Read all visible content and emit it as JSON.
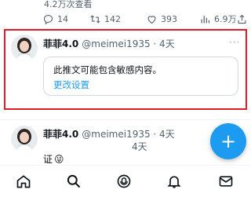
{
  "prev_tweet": {
    "views_text": "4.2万次查看",
    "stats": {
      "replies": "14",
      "retweets": "142",
      "likes": "393",
      "views": "6.9万"
    }
  },
  "tweet1": {
    "name": "菲菲4.0",
    "handle_time": "@meimei1935 · 4天",
    "more": "···",
    "sensitive_text": "此推文可能包含敏感内容。",
    "settings_link": "更改设置"
  },
  "tweet2": {
    "name": "菲菲4.0",
    "handle_time": "@meimei1935 · 4天",
    "time2": "4天",
    "body": "证",
    "emoji": "😜"
  },
  "fab": {
    "symbol": "+"
  },
  "colors": {
    "accent": "#1d9bf0",
    "highlight": "#e01e2b",
    "secondary": "#536471"
  },
  "icons": [
    "reply-icon",
    "retweet-icon",
    "like-icon",
    "views-icon",
    "share-icon",
    "home-icon",
    "search-icon",
    "spaces-icon",
    "notifications-icon",
    "messages-icon"
  ]
}
